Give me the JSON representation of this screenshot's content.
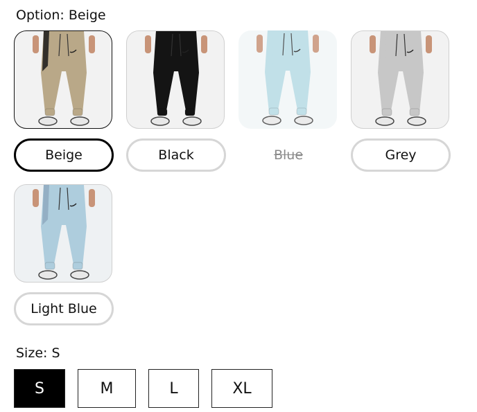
{
  "color_option": {
    "label_prefix": "Option:",
    "selected": "Beige",
    "swatches": [
      {
        "name": "Beige",
        "state": "selected",
        "pant_color": "#b9a888",
        "accent_color": "#1a1a1a",
        "bg_color": "#f2f2f2",
        "icon": "pants-image"
      },
      {
        "name": "Black",
        "state": "available",
        "pant_color": "#141414",
        "accent_color": "#141414",
        "bg_color": "#f2f2f2",
        "icon": "pants-image"
      },
      {
        "name": "Blue",
        "state": "sold-out",
        "pant_color": "#b7dbe4",
        "accent_color": "#b7dbe4",
        "bg_color": "#f2f6f7",
        "icon": "pants-image"
      },
      {
        "name": "Grey",
        "state": "available",
        "pant_color": "#c7c7c7",
        "accent_color": "#c7c7c7",
        "bg_color": "#f2f2f2",
        "icon": "pants-image"
      },
      {
        "name": "Light Blue",
        "state": "available",
        "pant_color": "#aecddd",
        "accent_color": "#8fa9bf",
        "bg_color": "#eef1f3",
        "icon": "pants-image"
      }
    ]
  },
  "size_option": {
    "label_prefix": "Size:",
    "selected": "S",
    "sizes": [
      "S",
      "M",
      "L",
      "XL"
    ]
  }
}
